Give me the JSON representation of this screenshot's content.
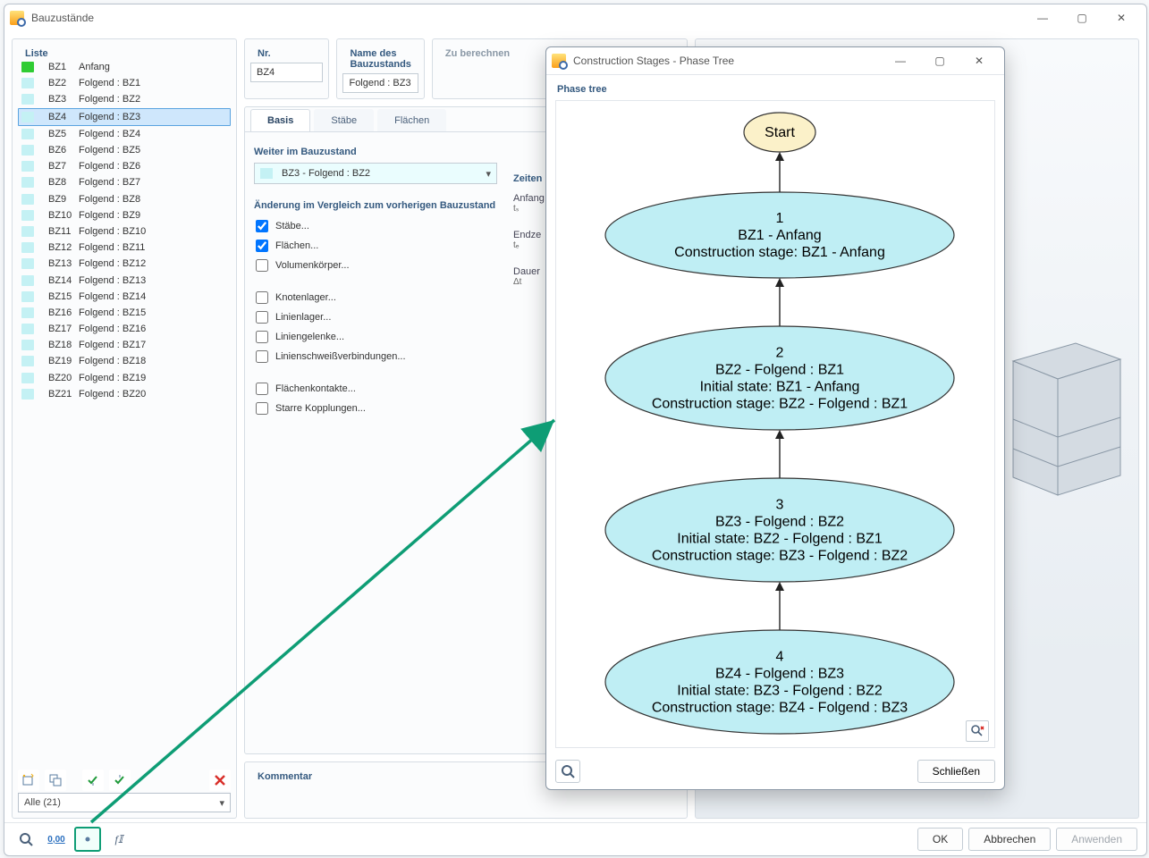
{
  "main": {
    "title": "Bauzustände",
    "footer": {
      "ok": "OK",
      "cancel": "Abbrechen",
      "apply": "Anwenden"
    }
  },
  "list": {
    "title": "Liste",
    "filter": "Alle (21)",
    "items": [
      {
        "id": "BZ1",
        "name": "Anfang",
        "sw": "green"
      },
      {
        "id": "BZ2",
        "name": "Folgend : BZ1",
        "sw": "cyan"
      },
      {
        "id": "BZ3",
        "name": "Folgend : BZ2",
        "sw": "cyan"
      },
      {
        "id": "BZ4",
        "name": "Folgend : BZ3",
        "sw": "cyan",
        "selected": true
      },
      {
        "id": "BZ5",
        "name": "Folgend : BZ4",
        "sw": "cyan"
      },
      {
        "id": "BZ6",
        "name": "Folgend : BZ5",
        "sw": "cyan"
      },
      {
        "id": "BZ7",
        "name": "Folgend : BZ6",
        "sw": "cyan"
      },
      {
        "id": "BZ8",
        "name": "Folgend : BZ7",
        "sw": "cyan"
      },
      {
        "id": "BZ9",
        "name": "Folgend : BZ8",
        "sw": "cyan"
      },
      {
        "id": "BZ10",
        "name": "Folgend : BZ9",
        "sw": "cyan"
      },
      {
        "id": "BZ11",
        "name": "Folgend : BZ10",
        "sw": "cyan"
      },
      {
        "id": "BZ12",
        "name": "Folgend : BZ11",
        "sw": "cyan"
      },
      {
        "id": "BZ13",
        "name": "Folgend : BZ12",
        "sw": "cyan"
      },
      {
        "id": "BZ14",
        "name": "Folgend : BZ13",
        "sw": "cyan"
      },
      {
        "id": "BZ15",
        "name": "Folgend : BZ14",
        "sw": "cyan"
      },
      {
        "id": "BZ16",
        "name": "Folgend : BZ15",
        "sw": "cyan"
      },
      {
        "id": "BZ17",
        "name": "Folgend : BZ16",
        "sw": "cyan"
      },
      {
        "id": "BZ18",
        "name": "Folgend : BZ17",
        "sw": "cyan"
      },
      {
        "id": "BZ19",
        "name": "Folgend : BZ18",
        "sw": "cyan"
      },
      {
        "id": "BZ20",
        "name": "Folgend : BZ19",
        "sw": "cyan"
      },
      {
        "id": "BZ21",
        "name": "Folgend : BZ20",
        "sw": "cyan"
      }
    ]
  },
  "detail": {
    "nr_label": "Nr.",
    "nr_value": "BZ4",
    "name_label": "Name des Bauzustands",
    "name_value": "Folgend : BZ3",
    "tabs": [
      "Basis",
      "Stäbe",
      "Flächen"
    ],
    "continue_label": "Weiter im Bauzustand",
    "continue_value": "BZ3 - Folgend : BZ2",
    "changes_label": "Änderung im Vergleich zum vorherigen Bauzustand",
    "checks": [
      {
        "label": "Stäbe...",
        "on": true
      },
      {
        "label": "Flächen...",
        "on": true
      },
      {
        "label": "Volumenkörper...",
        "on": false
      },
      {
        "label": "Knotenlager...",
        "on": false
      },
      {
        "label": "Linienlager...",
        "on": false
      },
      {
        "label": "Liniengelenke...",
        "on": false
      },
      {
        "label": "Linienschweißverbindungen...",
        "on": false
      },
      {
        "label": "Flächenkontakte...",
        "on": false
      },
      {
        "label": "Starre Kopplungen...",
        "on": false
      }
    ],
    "time": {
      "title": "Zeiten",
      "start_lab": "Anfang",
      "start_sym": "tₛ",
      "end_lab": "Endze",
      "end_sym": "tₑ",
      "dur_lab": "Dauer",
      "dur_sym": "Δt"
    },
    "comment_label": "Kommentar",
    "berechnen": "Zu berechnen"
  },
  "phase": {
    "win_title": "Construction Stages - Phase Tree",
    "tree_title": "Phase tree",
    "close": "Schließen",
    "start": "Start",
    "nodes": [
      {
        "n": "1",
        "lines": [
          "BZ1 - Anfang",
          "Construction stage: BZ1 - Anfang"
        ]
      },
      {
        "n": "2",
        "lines": [
          "BZ2 - Folgend : BZ1",
          "Initial state: BZ1 - Anfang",
          "Construction stage: BZ2 - Folgend : BZ1"
        ]
      },
      {
        "n": "3",
        "lines": [
          "BZ3 - Folgend : BZ2",
          "Initial state: BZ2 - Folgend : BZ1",
          "Construction stage: BZ3 - Folgend : BZ2"
        ]
      },
      {
        "n": "4",
        "lines": [
          "BZ4 - Folgend : BZ3",
          "Initial state: BZ3 - Folgend : BZ2",
          "Construction stage: BZ4 - Folgend : BZ3"
        ]
      }
    ]
  }
}
